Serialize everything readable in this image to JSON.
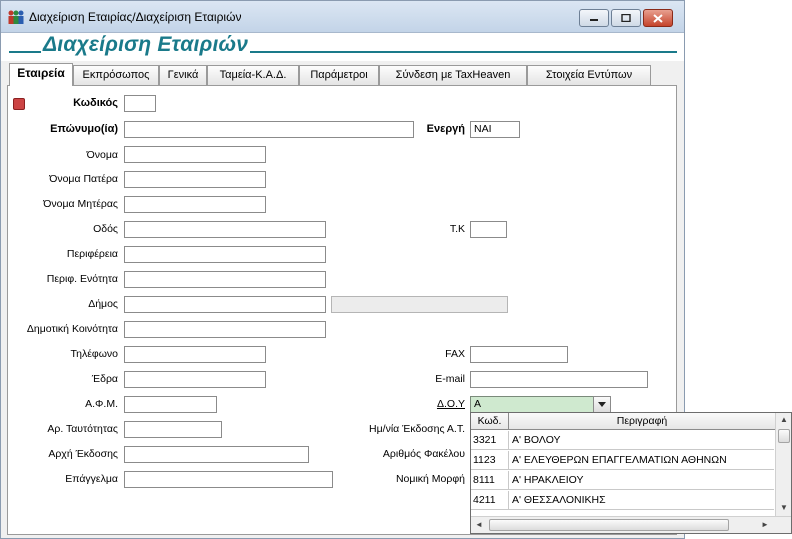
{
  "window": {
    "title": "Διαχείριση Εταιρίας/Διαχείριση Εταιριών"
  },
  "header": {
    "title": "Διαχείριση Εταιριών"
  },
  "tabs": [
    {
      "label": "Εταιρεία",
      "active": true
    },
    {
      "label": "Εκπρόσωπος"
    },
    {
      "label": "Γενικά"
    },
    {
      "label": "Ταμεία-Κ.Α.Δ."
    },
    {
      "label": "Παράμετροι"
    },
    {
      "label": "Σύνδεση με TaxHeaven"
    },
    {
      "label": "Στοιχεία Εντύπων"
    }
  ],
  "form": {
    "code_label": "Κωδικός",
    "code_value": "",
    "surname_label": "Επώνυμο(ία)",
    "surname_value": "",
    "active_label": "Ενεργή",
    "active_value": "ΝΑΙ",
    "name_label": "Όνομα",
    "father_label": "Όνομα Πατέρα",
    "mother_label": "Όνομα Μητέρας",
    "street_label": "Οδός",
    "zip_label": "Τ.Κ",
    "region_label": "Περιφέρεια",
    "regional_unit_label": "Περιφ. Ενότητα",
    "municipality_label": "Δήμος",
    "community_label": "Δημοτική Κοινότητα",
    "phone_label": "Τηλέφωνο",
    "fax_label": "FAX",
    "seat_label": "Έδρα",
    "email_label": "E-mail",
    "afm_label": "Α.Φ.Μ.",
    "doy_label": "Δ.Ο.Υ",
    "doy_value": "Α",
    "id_label": "Αρ. Ταυτότητας",
    "issue_date_label": "Ημ/νία Έκδοσης Α.Τ.",
    "issue_authority_label": "Αρχή Έκδοσης",
    "folder_label": "Αριθμός Φακέλου",
    "profession_label": "Επάγγελμα",
    "legal_form_label": "Νομική Μορφή"
  },
  "doy_dropdown": {
    "col_code": "Κωδ.",
    "col_desc": "Περιγραφή",
    "rows": [
      {
        "code": "3321",
        "desc": "Α' ΒΟΛΟΥ"
      },
      {
        "code": "1123",
        "desc": "Α' ΕΛΕΥΘΕΡΩΝ ΕΠΑΓΓΕΛΜΑΤΙΩΝ ΑΘΗΝΩΝ"
      },
      {
        "code": "8111",
        "desc": "Α' ΗΡΑΚΛΕΙΟΥ"
      },
      {
        "code": "4211",
        "desc": "Α' ΘΕΣΣΑΛΟΝΙΚΗΣ"
      }
    ]
  },
  "colors": {
    "accent": "#1a7a8a",
    "combo_bg": "#cfe9cf"
  }
}
